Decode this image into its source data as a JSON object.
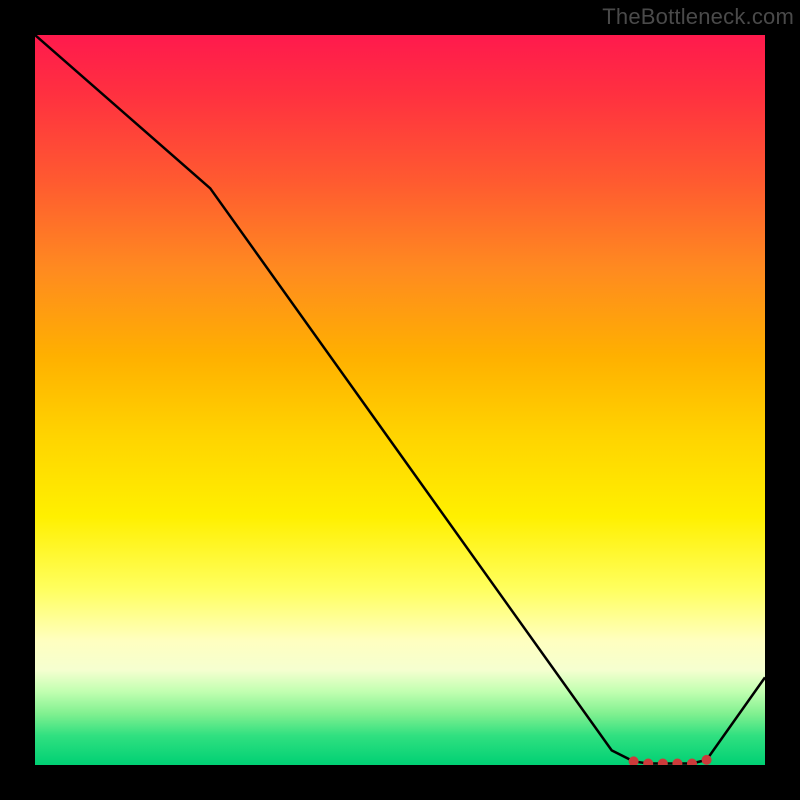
{
  "attribution": "TheBottleneck.com",
  "chart_data": {
    "type": "line",
    "title": "",
    "xlabel": "",
    "ylabel": "",
    "xlim": [
      0,
      100
    ],
    "ylim": [
      0,
      100
    ],
    "x": [
      0,
      24,
      79,
      82,
      84,
      86,
      88,
      90,
      92,
      100
    ],
    "values": [
      100,
      79,
      2,
      0.5,
      0.2,
      0.2,
      0.2,
      0.2,
      0.7,
      12
    ],
    "marker_indices": [
      3,
      4,
      5,
      6,
      7,
      8
    ],
    "marker_color": "#cc3b3b",
    "line_color": "#000000",
    "gradient_stops": [
      {
        "pos": 0.0,
        "color": "#ff1a4d"
      },
      {
        "pos": 0.5,
        "color": "#ffd400"
      },
      {
        "pos": 0.85,
        "color": "#ffffc0"
      },
      {
        "pos": 1.0,
        "color": "#00d074"
      }
    ]
  }
}
